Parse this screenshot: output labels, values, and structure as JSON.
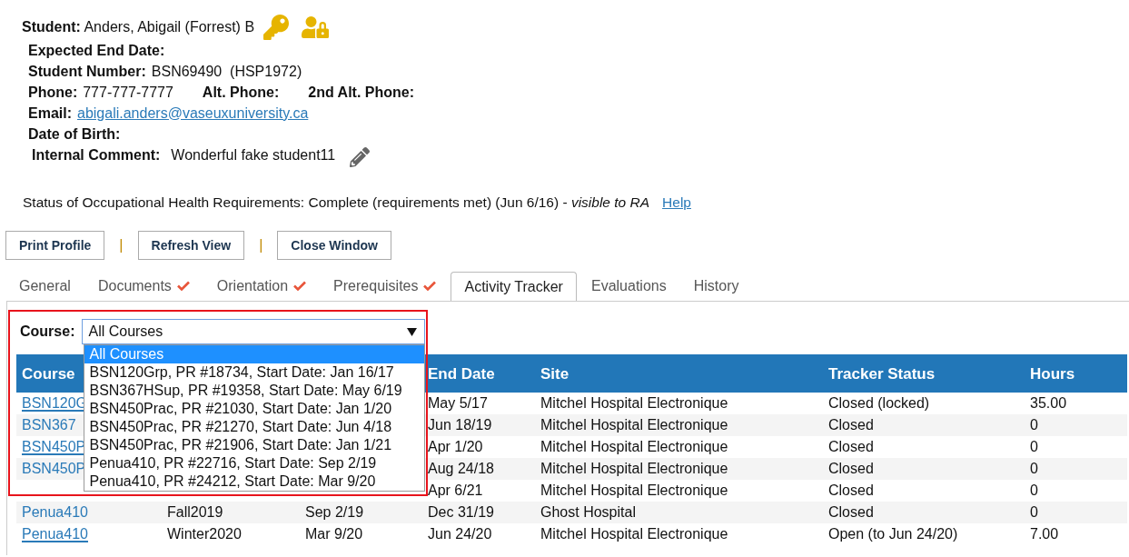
{
  "student": {
    "label": "Student:",
    "name": "Anders, Abigail (Forrest) B"
  },
  "info_lines": [
    {
      "items": [
        {
          "label": "Expected End Date:"
        }
      ]
    },
    {
      "items": [
        {
          "label": "Student Number:",
          "value": "BSN69490  (HSP1972)"
        }
      ]
    },
    {
      "items": [
        {
          "label": "Phone:",
          "value": "777-777-7777"
        },
        {
          "label": "Alt. Phone:"
        },
        {
          "label": "2nd Alt. Phone:"
        }
      ]
    },
    {
      "items": [
        {
          "label": "Email:",
          "link": "abigali.anders@vaseuxuniversity.ca"
        }
      ]
    },
    {
      "items": [
        {
          "label": "Date of Birth:"
        }
      ]
    },
    {
      "items": [
        {
          "label": "Internal Comment:",
          "value": "Wonderful fake student11"
        }
      ],
      "editable": true
    }
  ],
  "status": {
    "text": "Status of Occupational Health Requirements: Complete (requirements met) (Jun 6/16) - *visible to RA*",
    "help_link": "Help"
  },
  "toolbar": [
    {
      "kind": "button",
      "label": "Print Profile"
    },
    {
      "kind": "separator",
      "label": "|"
    },
    {
      "kind": "button",
      "label": "Refresh View"
    },
    {
      "kind": "separator",
      "label": "|"
    },
    {
      "kind": "button",
      "label": "Close Window"
    }
  ],
  "tabs": [
    {
      "label": "General",
      "selected": false,
      "complete": false
    },
    {
      "label": "Documents",
      "selected": false,
      "complete": true
    },
    {
      "label": "Orientation",
      "selected": false,
      "complete": true
    },
    {
      "label": "Prerequisites",
      "selected": false,
      "complete": true
    },
    {
      "label": "Activity Tracker",
      "selected": true,
      "complete": false
    },
    {
      "label": "Evaluations",
      "selected": false,
      "complete": false
    },
    {
      "label": "History",
      "selected": false,
      "complete": false
    }
  ],
  "course_filter": {
    "label": "Course:",
    "value": "All Courses",
    "expanded": true,
    "options": [
      {
        "label": "All Courses",
        "selected": true
      },
      {
        "label": "BSN120Grp, PR #18734, Start Date: Jan 16/17",
        "selected": false
      },
      {
        "label": "BSN367HSup, PR #19358, Start Date: May 6/19",
        "selected": false
      },
      {
        "label": "BSN450Prac, PR #21030, Start Date: Jan 1/20",
        "selected": false
      },
      {
        "label": "BSN450Prac, PR #21270, Start Date: Jun 4/18",
        "selected": false
      },
      {
        "label": "BSN450Prac, PR #21906, Start Date: Jan 1/21",
        "selected": false
      },
      {
        "label": "Penua410, PR #22716, Start Date: Sep 2/19",
        "selected": false
      },
      {
        "label": "Penua410, PR #24212, Start Date: Mar 9/20",
        "selected": false
      }
    ]
  },
  "table": {
    "columns": {
      "course": "Course",
      "end_date": "End Date",
      "site": "Site",
      "tracker_status": "Tracker Status",
      "hours": "Hours"
    },
    "rows": [
      {
        "course": "BSN120G",
        "underlined": true,
        "end_date": "May 5/17",
        "site": "Mitchel Hospital Electronique",
        "tracker_status": "Closed (locked)",
        "hours": "35.00"
      },
      {
        "course": "BSN367",
        "underlined": false,
        "end_date": "Jun 18/19",
        "site": "Mitchel Hospital Electronique",
        "tracker_status": "Closed",
        "hours": "0"
      },
      {
        "course": "BSN450P",
        "underlined": true,
        "end_date": "Apr 1/20",
        "site": "Mitchel Hospital Electronique",
        "tracker_status": "Closed",
        "hours": "0"
      },
      {
        "course": "BSN450P",
        "underlined": false,
        "end_date": "Aug 24/18",
        "site": "Mitchel Hospital Electronique",
        "tracker_status": "Closed",
        "hours": "0"
      },
      {
        "end_date": "Apr 6/21",
        "site": "Mitchel Hospital Electronique",
        "tracker_status": "Closed",
        "hours": "0"
      },
      {
        "course": "Penua410",
        "underlined": false,
        "column_2": "Fall2019",
        "column_3": "Sep 2/19",
        "end_date": "Dec 31/19",
        "site": "Ghost Hospital",
        "tracker_status": "Closed",
        "hours": "0"
      },
      {
        "course": "Penua410",
        "underlined": true,
        "column_2": "Winter2020",
        "column_3": "Mar 9/20",
        "end_date": "Jun 24/20",
        "site": "Mitchel Hospital Electronique",
        "tracker_status": "Open (to Jun 24/20)",
        "hours": "7.00"
      }
    ]
  }
}
